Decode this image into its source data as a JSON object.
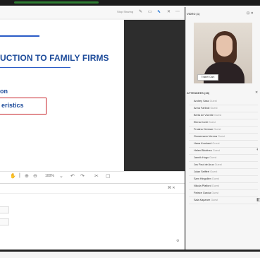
{
  "toolbar": {
    "status": "Stop Sharing",
    "icons": [
      "pen-icon",
      "screen-icon",
      "pointer-icon",
      "close-icon",
      "more-icon"
    ]
  },
  "slide": {
    "title": "UCTION TO FAMILY FIRMS",
    "subtitle": "on",
    "boxed_text": "eristics"
  },
  "zoom": {
    "value": "100%"
  },
  "video": {
    "heading": "VIDEO (1)",
    "controls": "⊡ ✕",
    "presenter_name": "Trainer Cam"
  },
  "attendees": {
    "heading": "ATTENDEES (38)",
    "role": "Guest",
    "names": [
      "Andrey Sass",
      "Anna Fariboli",
      "Berta de Vicente",
      "Elena Conti",
      "Frusina Herman",
      "Grosemann Verena",
      "Hana Kronland",
      "Helen Bikofneu",
      "Jannik Hugo",
      "Jos Paul de Aruz",
      "Julan Seiffert",
      "Sam Hingollen",
      "Nikola Pfalford",
      "Patrice Garcia",
      "Sala Kapaner"
    ]
  }
}
